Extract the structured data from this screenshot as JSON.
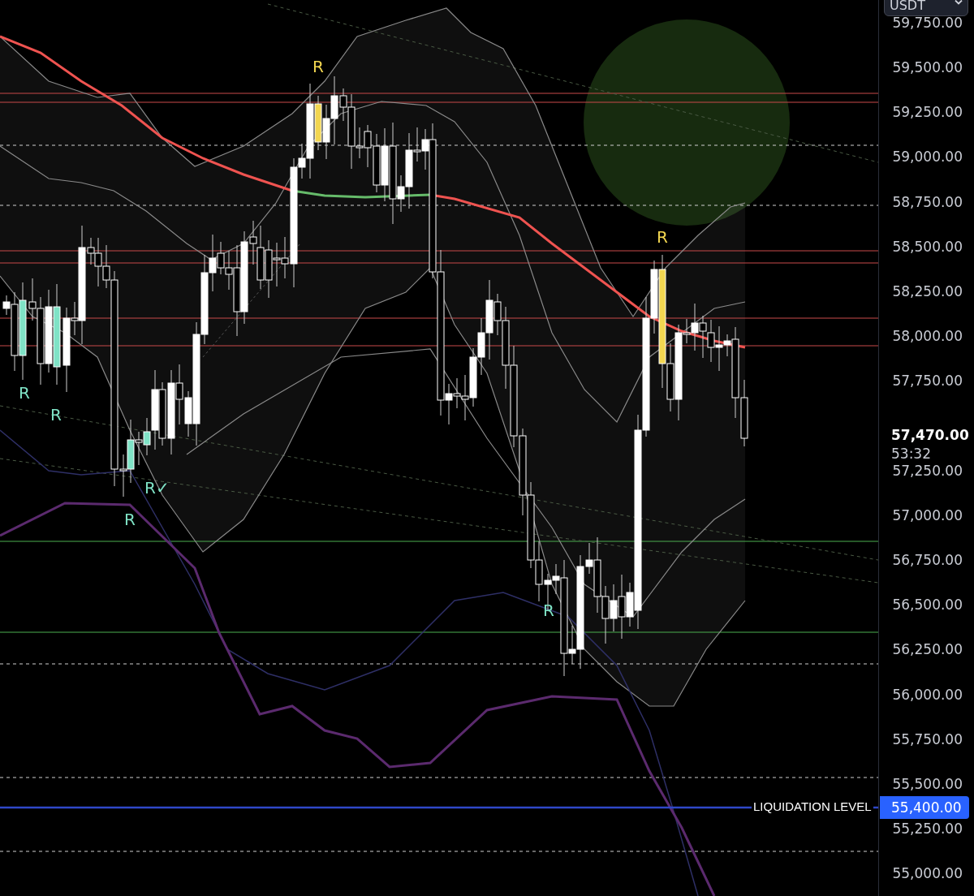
{
  "currency_selector": {
    "label": "USDT"
  },
  "price_axis": {
    "labels": [
      "59,750.00",
      "59,500.00",
      "59,250.00",
      "59,000.00",
      "58,750.00",
      "58,500.00",
      "58,250.00",
      "58,000.00",
      "57,750.00",
      "57,250.00",
      "57,000.00",
      "56,750.00",
      "56,500.00",
      "56,250.00",
      "56,000.00",
      "55,750.00",
      "55,500.00",
      "55,250.00",
      "55,000.00"
    ]
  },
  "current_price": {
    "price": "57,470.00",
    "countdown": "53:32"
  },
  "liquidation_level": {
    "label": "LIQUIDATION LEVEL",
    "price": "55,400.00"
  },
  "signal_markers": [
    {
      "text": "R",
      "color": "#f2d650"
    },
    {
      "text": "R",
      "color": "#f2d650"
    },
    {
      "text": "R",
      "color": "#7fe3c6"
    },
    {
      "text": "R",
      "color": "#7fe3c6"
    },
    {
      "text": "R✓",
      "color": "#7fe3c6"
    },
    {
      "text": "R",
      "color": "#7fe3c6"
    },
    {
      "text": "R",
      "color": "#7fe3c6"
    }
  ]
}
